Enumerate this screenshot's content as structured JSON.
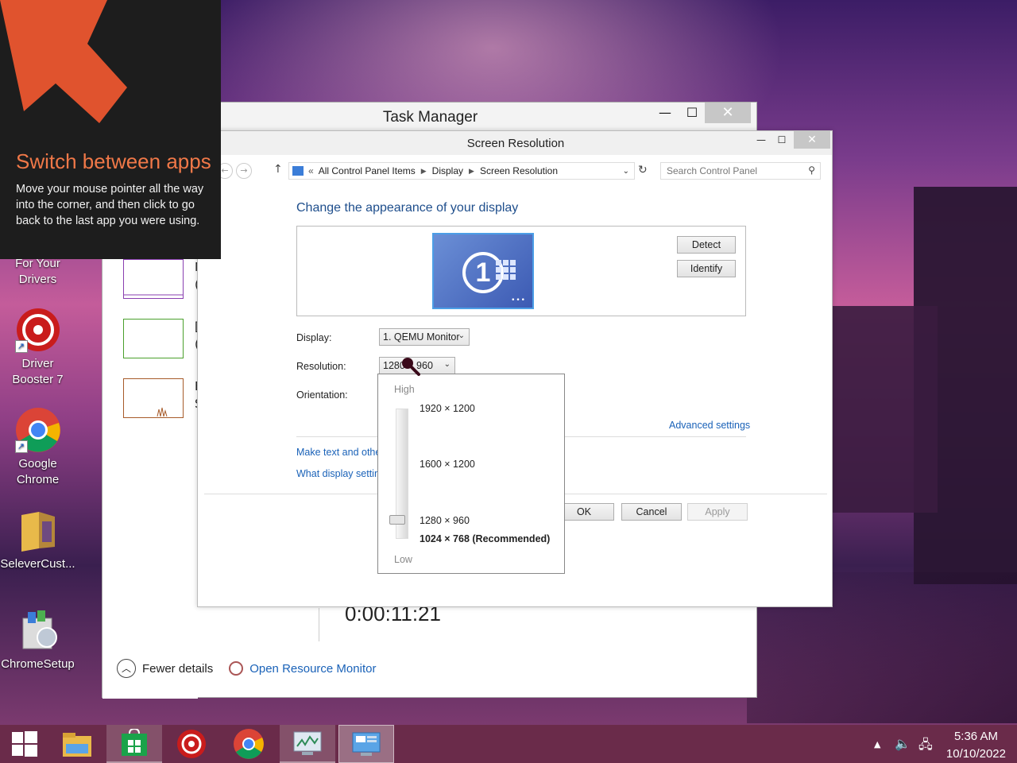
{
  "hint": {
    "title": "Switch between apps",
    "body": "Move your mouse pointer all the way into the corner, and then click to go back to the last app you were using."
  },
  "desktop_icons": [
    {
      "label": "For Your\nDrivers",
      "line1": "For Your",
      "line2": "Drivers"
    },
    {
      "line1": "Driver",
      "line2": "Booster 7"
    },
    {
      "line1": "Google",
      "line2": "Chrome"
    },
    {
      "line1": "SeleverCust..."
    },
    {
      "line1": "ChromeSetup"
    }
  ],
  "task_manager": {
    "title": "Task Manager",
    "rows": [
      {
        "label_line1": "N",
        "label_line2": "("
      },
      {
        "label_line1": "[",
        "label_line2": "("
      },
      {
        "label_line1": "E",
        "label_line2": "S"
      }
    ],
    "timer": "0:00:11:21",
    "fewer_details": "Fewer details",
    "open_resource_monitor": "Open Resource Monitor"
  },
  "screen_resolution": {
    "title": "Screen Resolution",
    "breadcrumb": [
      "All Control Panel Items",
      "Display",
      "Screen Resolution"
    ],
    "breadcrumb_prefix": "«",
    "search_placeholder": "Search Control Panel",
    "heading": "Change the appearance of your display",
    "monitor_number": "1",
    "detect_label": "Detect",
    "identify_label": "Identify",
    "display_label": "Display:",
    "display_value": "1. QEMU Monitor",
    "resolution_label": "Resolution:",
    "resolution_value": "1280 × 960",
    "orientation_label": "Orientation:",
    "advanced_settings": "Advanced settings",
    "make_text_link": "Make text and othe",
    "what_display_link": "What display settin",
    "ok_label": "OK",
    "cancel_label": "Cancel",
    "apply_label": "Apply"
  },
  "resolution_dropdown": {
    "high_label": "High",
    "low_label": "Low",
    "options": [
      "1920 × 1200",
      "1600 × 1200",
      "1280 × 960",
      "1024 × 768 (Recommended)"
    ],
    "selected": "1280 × 960"
  },
  "taskbar": {
    "clock_time": "5:36 AM",
    "clock_date": "10/10/2022",
    "items": [
      "start-icon",
      "file-explorer-icon",
      "store-icon",
      "driver-booster-icon",
      "chrome-icon",
      "task-manager-icon",
      "control-panel-icon"
    ]
  },
  "colors": {
    "hint_title": "#f07848",
    "link_blue": "#1a62b8",
    "heading_blue": "#1e4e8c",
    "taskbar": "#6a2b4a"
  }
}
